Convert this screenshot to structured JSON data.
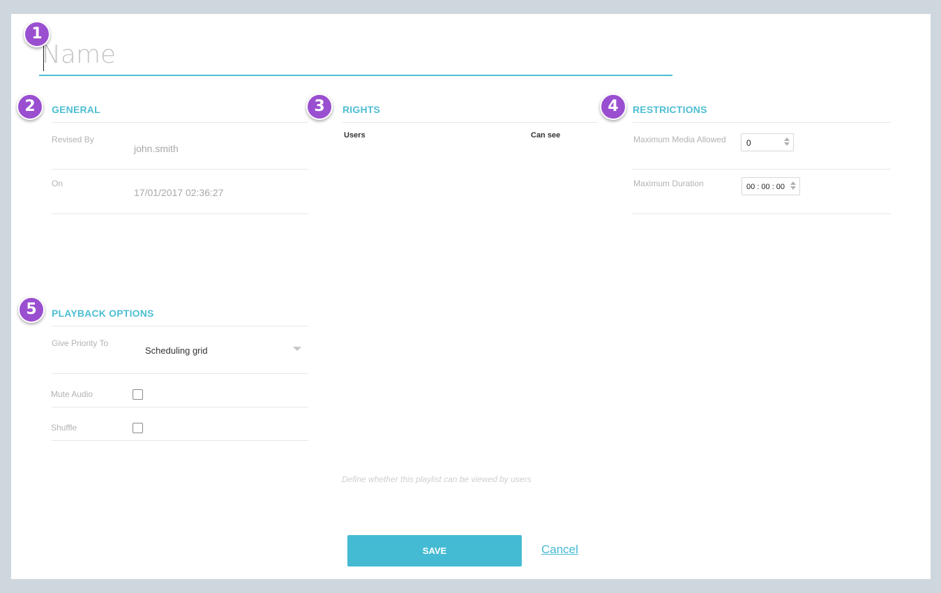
{
  "name": {
    "placeholder": "Name",
    "value": ""
  },
  "badges": [
    "1",
    "2",
    "3",
    "4",
    "5"
  ],
  "general": {
    "title": "GENERAL",
    "revised_by_label": "Revised By",
    "revised_by_value": "john.smith",
    "on_label": "On",
    "on_value": "17/01/2017 02:36:27"
  },
  "rights": {
    "title": "RIGHTS",
    "col_users": "Users",
    "col_can_see": "Can see",
    "hint": "Define whether this playlist can be viewed by users"
  },
  "restrictions": {
    "title": "RESTRICTIONS",
    "max_media_label": "Maximum Media Allowed",
    "max_media_value": "0",
    "max_duration_label": "Maximum Duration",
    "max_duration_value": "00 : 00 : 00"
  },
  "playback": {
    "title": "PLAYBACK OPTIONS",
    "priority_label": "Give Priority To",
    "priority_value": "Scheduling grid",
    "mute_label": "Mute Audio",
    "mute_checked": false,
    "shuffle_label": "Shuffle",
    "shuffle_checked": false
  },
  "actions": {
    "save_label": "SAVE",
    "cancel_label": "Cancel"
  },
  "colors": {
    "accent": "#4dbed3",
    "badge": "#9a4fd0",
    "background": "#cfd7de"
  }
}
